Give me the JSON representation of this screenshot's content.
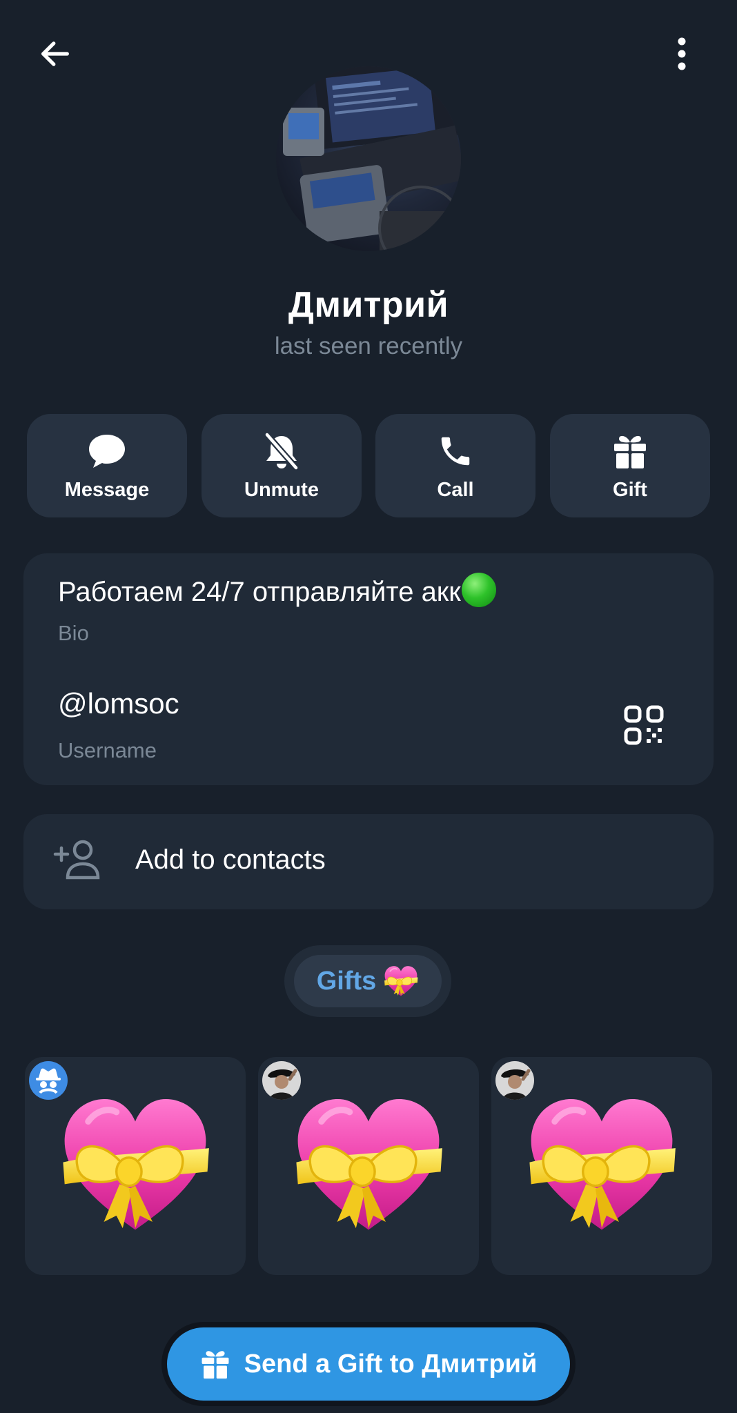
{
  "header": {
    "back_icon": "arrow-left-icon",
    "menu_icon": "more-vertical-icon"
  },
  "profile": {
    "name": "Дмитрий",
    "status": "last seen recently"
  },
  "actions": [
    {
      "label": "Message",
      "icon": "message-bubble-icon"
    },
    {
      "label": "Unmute",
      "icon": "bell-off-icon"
    },
    {
      "label": "Call",
      "icon": "phone-icon"
    },
    {
      "label": "Gift",
      "icon": "gift-icon"
    }
  ],
  "info": {
    "bio": "Работаем 24/7 отправляйте акк",
    "bio_emoji": "green-circle",
    "bio_label": "Bio",
    "username": "@lomsoc",
    "username_label": "Username",
    "qr_icon": "qr-code-icon"
  },
  "contact": {
    "label": "Add to contacts",
    "icon": "add-person-icon"
  },
  "gifts": {
    "label": "Gifts",
    "label_emoji": "heart-with-ribbon",
    "items": [
      {
        "gift": "heart-with-ribbon",
        "sender": "anonymous-icon"
      },
      {
        "gift": "heart-with-ribbon",
        "sender": "user-avatar"
      },
      {
        "gift": "heart-with-ribbon",
        "sender": "user-avatar"
      }
    ]
  },
  "send_gift": {
    "label": "Send a Gift to Дмитрий",
    "icon": "gift-icon"
  },
  "colors": {
    "background": "#18202b",
    "card": "#202a37",
    "button": "#273241",
    "accent": "#2f96e3",
    "gifts_text": "#62a7e6",
    "secondary_text": "#7b8896"
  }
}
